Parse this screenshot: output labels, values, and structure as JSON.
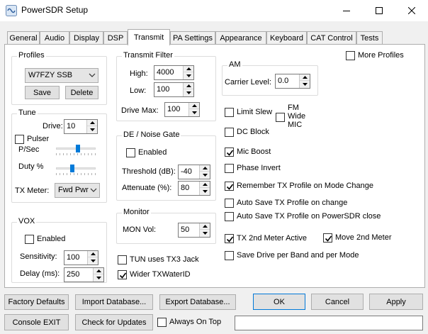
{
  "window": {
    "title": "PowerSDR Setup"
  },
  "tabs": [
    {
      "label": "General"
    },
    {
      "label": "Audio"
    },
    {
      "label": "Display"
    },
    {
      "label": "DSP"
    },
    {
      "label": "Transmit"
    },
    {
      "label": "PA Settings"
    },
    {
      "label": "Appearance"
    },
    {
      "label": "Keyboard"
    },
    {
      "label": "CAT Control"
    },
    {
      "label": "Tests"
    }
  ],
  "selected_tab": "Transmit",
  "profiles": {
    "title": "Profiles",
    "selected": "W7FZY SSB",
    "save": "Save",
    "delete": "Delete"
  },
  "tune": {
    "title": "Tune",
    "drive_label": "Drive:",
    "drive_value": "10",
    "pulser_label": "Pulser",
    "pulser_checked": false,
    "psec_label": "P/Sec",
    "psec_level": 0.55,
    "duty_label": "Duty %",
    "duty_level": 0.4,
    "txmeter_label": "TX Meter:",
    "txmeter_value": "Fwd Pwr"
  },
  "vox": {
    "title": "VOX",
    "enabled_label": "Enabled",
    "enabled_checked": false,
    "sensitivity_label": "Sensitivity:",
    "sensitivity_value": "100",
    "delay_label": "Delay (ms):",
    "delay_value": "250"
  },
  "transmit_filter": {
    "title": "Transmit Filter",
    "high_label": "High:",
    "high_value": "4000",
    "low_label": "Low:",
    "low_value": "100",
    "drivemax_label": "Drive Max:",
    "drivemax_value": "100"
  },
  "noise_gate": {
    "title": "DE / Noise Gate",
    "enabled_label": "Enabled",
    "enabled_checked": false,
    "threshold_label": "Threshold (dB):",
    "threshold_value": "-40",
    "attenuate_label": "Attenuate (%):",
    "attenuate_value": "80"
  },
  "monitor": {
    "title": "Monitor",
    "monvol_label": "MON Vol:",
    "monvol_value": "50"
  },
  "misc": {
    "tun_uses_tx3_label": "TUN uses TX3 Jack",
    "tun_uses_tx3_checked": false,
    "wider_txwater_label": "Wider TXWaterID",
    "wider_txwater_checked": true
  },
  "more_profiles": {
    "label": "More Profiles",
    "checked": false
  },
  "am": {
    "title": "AM",
    "carrier_label": "Carrier Level:",
    "carrier_value": "0.0"
  },
  "options": {
    "limit_slew": "Limit Slew",
    "fm_wide_mic_1": "FM",
    "fm_wide_mic_2": "Wide",
    "fm_wide_mic_3": "MIC",
    "dc_block": "DC Block",
    "mic_boost": "Mic Boost",
    "phase_invert": "Phase Invert",
    "remember_tx": "Remember TX Profile on Mode Change",
    "autosave_change": "Auto Save TX Profile on change",
    "autosave_close": "Auto Save TX Profile on PowerSDR close",
    "tx_2nd_meter": "TX 2nd Meter Active",
    "move_2nd_meter": "Move 2nd Meter",
    "save_drive": "Save Drive per Band and per Mode"
  },
  "footer": {
    "factory_defaults": "Factory Defaults",
    "import_db": "Import Database...",
    "export_db": "Export Database...",
    "ok": "OK",
    "cancel": "Cancel",
    "apply": "Apply",
    "console_exit": "Console EXIT",
    "check_updates": "Check for Updates",
    "always_on_top": "Always On Top",
    "status_text": ""
  },
  "colors": {
    "accent": "#007ad9",
    "tab_border": "#adadad",
    "button_bg": "#e1e1e1"
  }
}
